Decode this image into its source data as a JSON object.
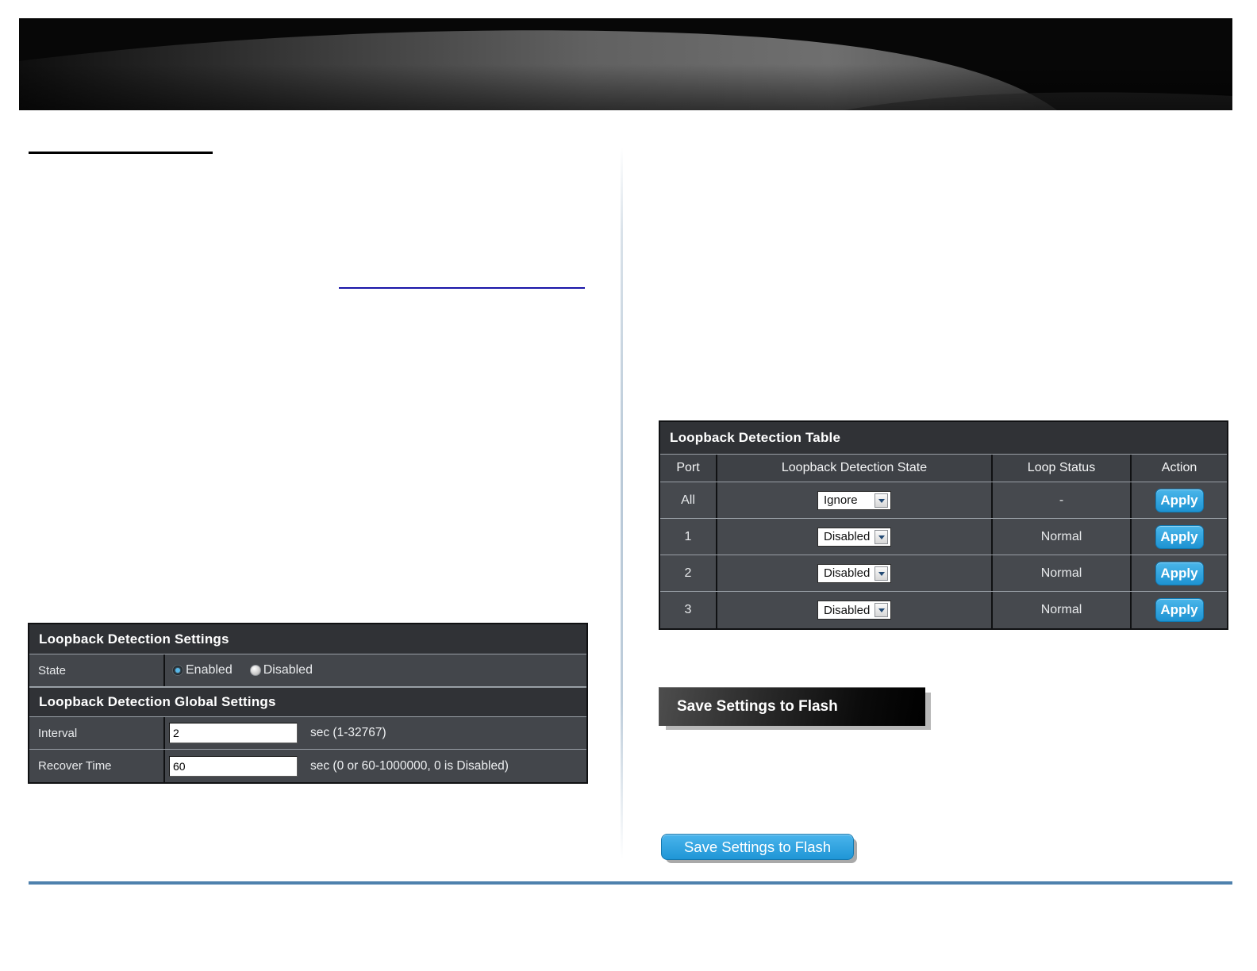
{
  "settings_panel": {
    "title": "Loopback Detection Settings",
    "state_row": {
      "label": "State",
      "selected": "Enabled",
      "options": [
        {
          "label": "Enabled"
        },
        {
          "label": "Disabled"
        }
      ]
    },
    "global_title": "Loopback Detection Global Settings",
    "fields": [
      {
        "label": "Interval",
        "value": "2",
        "hint": "sec (1-32767)"
      },
      {
        "label": "Recover Time",
        "value": "60",
        "hint": "sec (0 or 60-1000000, 0 is Disabled)"
      }
    ]
  },
  "port_table": {
    "title": "Loopback Detection Table",
    "columns": [
      "Port",
      "Loopback Detection State",
      "Loop Status",
      "Action"
    ],
    "rows": [
      {
        "port": "All",
        "state": "Ignore",
        "loop_status": "-",
        "action": "Apply"
      },
      {
        "port": "1",
        "state": "Disabled",
        "loop_status": "Normal",
        "action": "Apply"
      },
      {
        "port": "2",
        "state": "Disabled",
        "loop_status": "Normal",
        "action": "Apply"
      },
      {
        "port": "3",
        "state": "Disabled",
        "loop_status": "Normal",
        "action": "Apply"
      }
    ]
  },
  "save_section_banner": {
    "label": "Save Settings to Flash"
  },
  "save_button": {
    "label": "Save Settings to Flash"
  },
  "colors": {
    "apply_button_blue": "#2aa1de",
    "table_title_bg": "#303236",
    "table_row_bg": "#46494e",
    "footer_rule_blue": "#4e81ad",
    "link_rule_navy": "#1a16a8",
    "heading_rule_black": "#000000",
    "column_divider": "#b2c4d4"
  }
}
